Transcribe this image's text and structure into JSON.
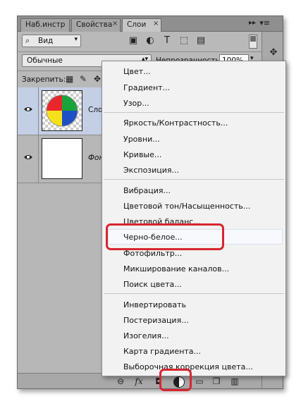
{
  "tabs": [
    {
      "label": "Наб.инстр"
    },
    {
      "label": "Свойства"
    },
    {
      "label": "Слои"
    }
  ],
  "tab_close_glyph": "×",
  "panel_menu_glyph": "▸▸ ▾≡",
  "filter": {
    "label": "Вид"
  },
  "blend": {
    "mode": "Обычные",
    "opacity_label": "Непрозрачность:",
    "opacity_value": "100%"
  },
  "lock": {
    "label": "Закрепить:"
  },
  "layers": [
    {
      "name": "Сло",
      "selected": true,
      "thumb": "color-wheel"
    },
    {
      "name": "Фон",
      "selected": false,
      "thumb": "white"
    }
  ],
  "menu": {
    "groups": [
      [
        "Цвет...",
        "Градиент...",
        "Узор..."
      ],
      [
        "Яркость/Контрастность...",
        "Уровни...",
        "Кривые...",
        "Экспозиция..."
      ],
      [
        "Вибрация...",
        "Цветовой тон/Насыщенность...",
        "Цветовой баланс...",
        "Черно-белое...",
        "Фотофильтр...",
        "Микширование каналов...",
        "Поиск цвета..."
      ],
      [
        "Инвертировать",
        "Постеризация...",
        "Изогелия...",
        "Карта градиента...",
        "Выборочная коррекция цвета..."
      ]
    ],
    "highlighted": "Черно-белое..."
  },
  "bottom_icons": [
    "link-icon",
    "fx-icon",
    "mask-icon",
    "adjustment-layer-icon",
    "group-icon",
    "new-layer-icon",
    "trash-icon"
  ],
  "colors": {
    "callout": "#d72630",
    "selected_layer": "#c4cfe6"
  }
}
